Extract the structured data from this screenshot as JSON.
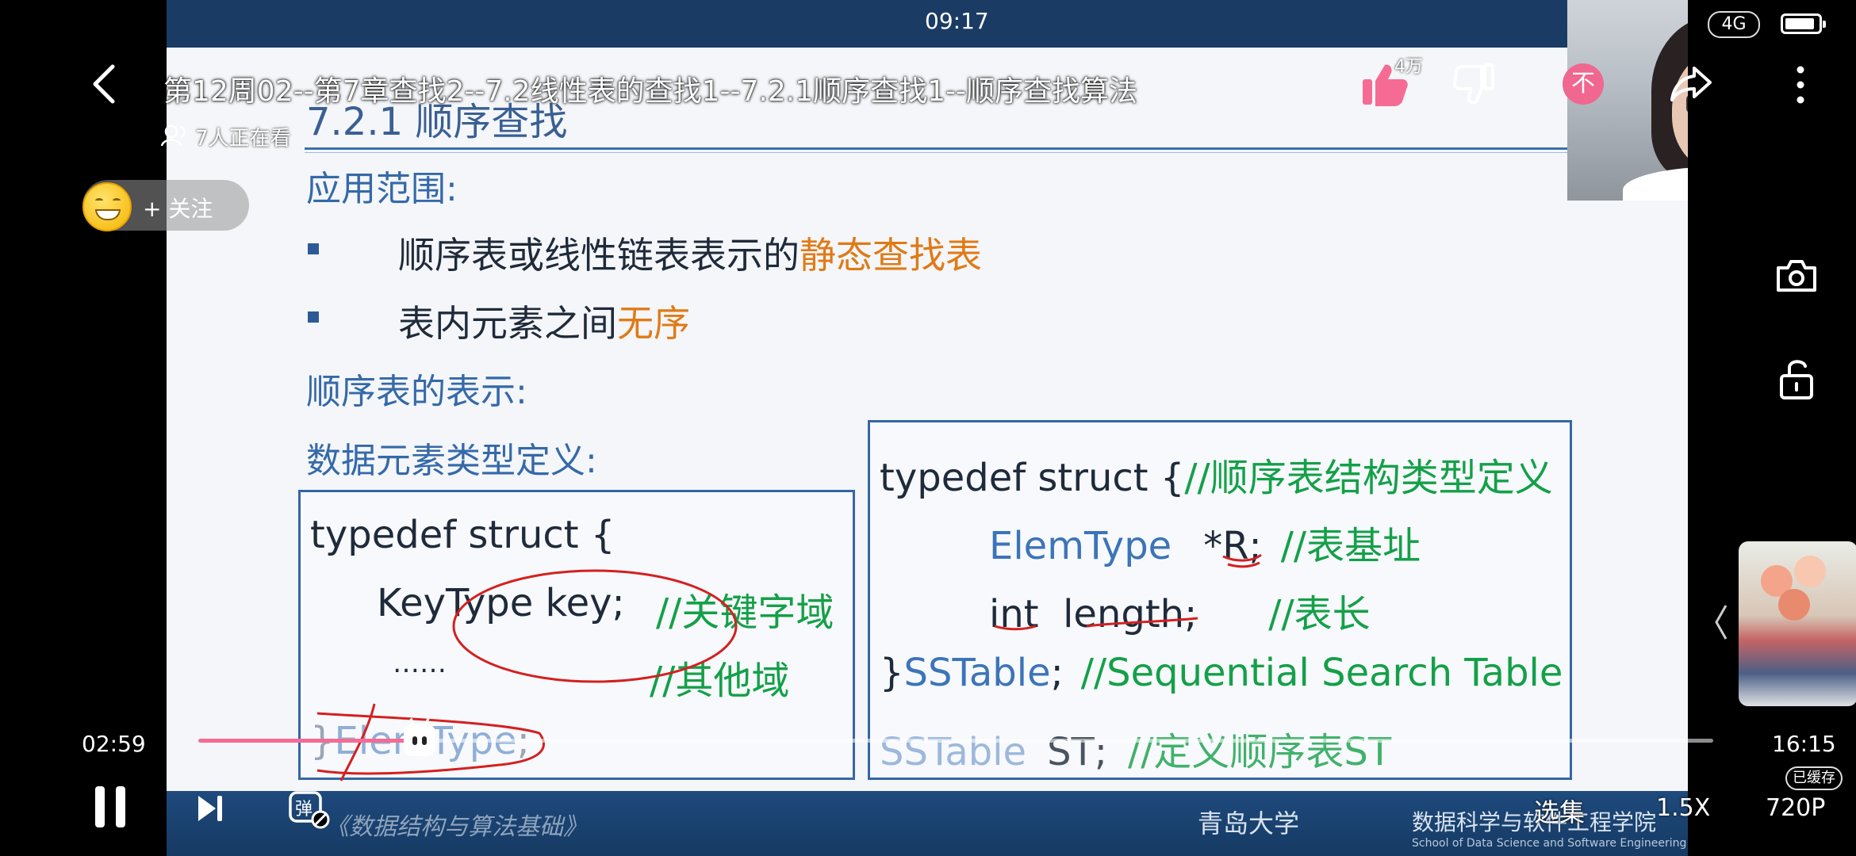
{
  "status_bar": {
    "time": "09:17",
    "network": "4G"
  },
  "header": {
    "title": "第12周02--第7章查找2--7.2线性表的查找1--7.2.1顺序查找1--顺序查找算法",
    "viewers": "7人正在看",
    "like_count": "4万",
    "coin_label": "不"
  },
  "follow": {
    "label": "+ 关注"
  },
  "slide": {
    "heading": "7.2.1 顺序查找",
    "scope_label": "应用范围:",
    "bullet1_prefix": "顺序表或线性链表表示的",
    "bullet1_highlight": "静态查找表",
    "bullet2_prefix": "表内元素之间",
    "bullet2_highlight": "无序",
    "repr_label": "顺序表的表示:",
    "elem_def_label": "数据元素类型定义:",
    "left_code": {
      "line1": "typedef struct {",
      "line2_code": "KeyType key;",
      "line2_comment": "//关键字域",
      "line3_code": "……",
      "line3_comment": "//其他域",
      "line4_brace": "}",
      "line4_type": "ElemType",
      "line4_end": ";"
    },
    "right_code": {
      "line1_code": "typedef struct {",
      "line1_comment": "//顺序表结构类型定义",
      "line2_type": "ElemType",
      "line2_var": "*R;",
      "line2_comment": "//表基址",
      "line3_code": "int  length;",
      "line3_comment": "//表长",
      "line4_brace": "}",
      "line4_type": "SSTable",
      "line4_semi": ";",
      "line4_comment": "//Sequential Search Table",
      "line5_type": "SSTable",
      "line5_var": "ST;",
      "line5_comment": "//定义顺序表ST"
    },
    "course": "《数据结构与算法基础》",
    "school_cn": "数据科学与软件工程学院",
    "school_en": "School of Data Science and Software Engineering",
    "university": "青岛大学"
  },
  "player": {
    "current_time": "02:59",
    "total_time": "16:15",
    "progress": 0.146,
    "episodes_label": "选集",
    "speed_label": "1.5X",
    "quality_label": "720P",
    "cached_label": "已缓存",
    "danmaku_label": "弹"
  },
  "colors": {
    "progress_played": "#f56b94",
    "slide_heading": "#3569a8",
    "slide_highlight": "#e07a16",
    "code_comment": "#14a048",
    "code_type": "#3c74b8",
    "coin_badge": "#f06790"
  }
}
